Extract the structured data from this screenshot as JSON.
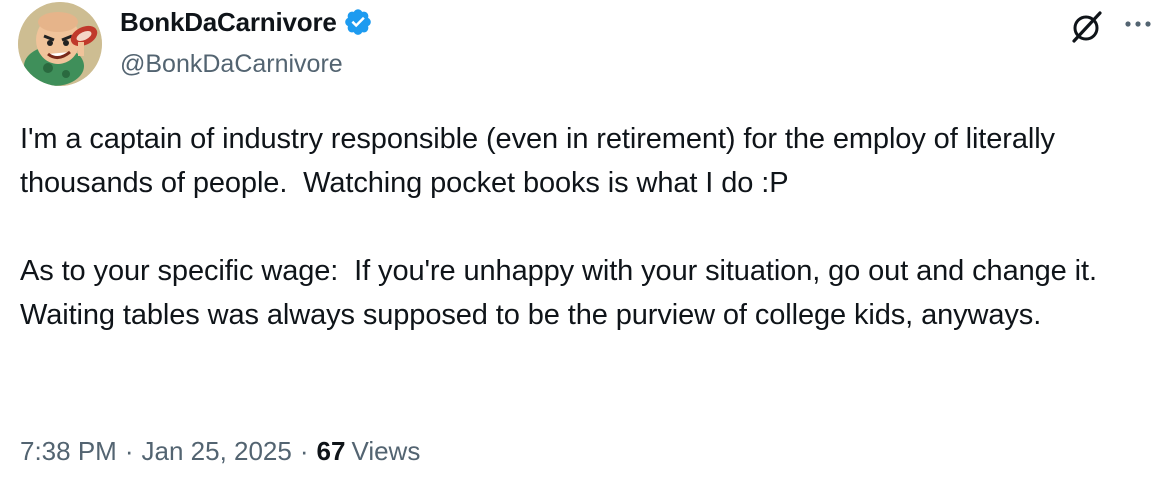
{
  "author": {
    "display_name": "BonkDaCarnivore",
    "handle": "@BonkDaCarnivore",
    "verified": true
  },
  "tweet": {
    "paragraphs": [
      "I'm a captain of industry responsible (even in retirement) for the employ of literally thousands of people.  Watching pocket books is what I do :P",
      "As to your specific wage:  If you're unhappy with your situation, go out and change it.  Waiting tables was always supposed to be the purview of college kids, anyways."
    ]
  },
  "meta": {
    "time": "7:38 PM",
    "separator": "·",
    "date": "Jan 25, 2025",
    "views_count": "67",
    "views_label": "Views"
  },
  "icons": {
    "verified": "verified-badge-icon",
    "grok": "grok-icon",
    "more": "more-icon"
  },
  "colors": {
    "text": "#0f1419",
    "secondary": "#536471",
    "verified": "#1d9bf0",
    "background": "#ffffff"
  }
}
